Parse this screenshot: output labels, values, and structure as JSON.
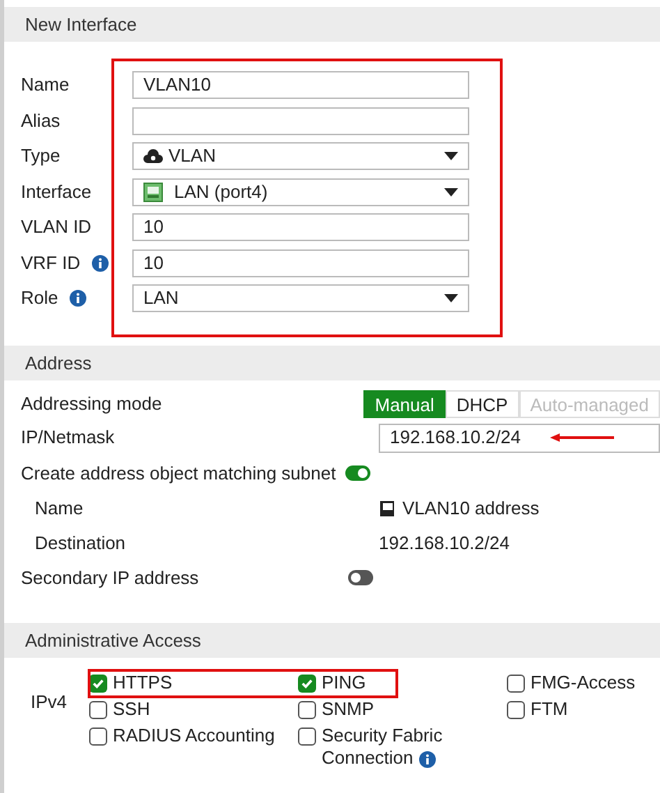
{
  "sections": [
    {
      "title": "New Interface"
    },
    {
      "title": "Address"
    },
    {
      "title": "Administrative Access"
    }
  ],
  "interface_fields": [
    {
      "label": "Name",
      "kind": "text",
      "value": "VLAN10",
      "info": false
    },
    {
      "label": "Alias",
      "kind": "text",
      "info": false
    },
    {
      "label": "Type",
      "kind": "select",
      "value": "VLAN",
      "info": false
    },
    {
      "label": "Interface",
      "kind": "select",
      "value": "LAN (port4)",
      "info": false
    },
    {
      "label": "VLAN ID",
      "kind": "text",
      "value": "10",
      "info": false
    },
    {
      "label": "VRF ID",
      "kind": "text",
      "value": "10",
      "info": true
    },
    {
      "label": "Role",
      "kind": "select",
      "value": "LAN",
      "info": true
    }
  ],
  "address": {
    "mode_label": "Addressing mode",
    "modes": [
      {
        "label": "Manual",
        "selected": true,
        "disabled": false
      },
      {
        "label": "DHCP",
        "selected": false,
        "disabled": false
      },
      {
        "label": "Auto-managed",
        "selected": false,
        "disabled": true
      }
    ],
    "ip_label": "IP/Netmask",
    "ip_value": "192.168.10.2/24",
    "create_label": "Create address object matching subnet",
    "create_on": true,
    "name_label": "Name",
    "name_value": "VLAN10 address",
    "dest_label": "Destination",
    "dest_value": "192.168.10.2/24",
    "secondary_label": "Secondary IP address",
    "secondary_on": false
  },
  "access": {
    "label": "IPv4",
    "options": [
      {
        "label": "HTTPS",
        "checked": true,
        "info": false
      },
      {
        "label": "PING",
        "checked": true,
        "info": false
      },
      {
        "label": "FMG-Access",
        "checked": false,
        "info": false
      },
      {
        "label": "SSH",
        "checked": false,
        "info": false
      },
      {
        "label": "SNMP",
        "checked": false,
        "info": false
      },
      {
        "label": "FTM",
        "checked": false,
        "info": false
      },
      {
        "label": "RADIUS Accounting",
        "checked": false,
        "info": false
      },
      {
        "label": "Security Fabric Connection",
        "checked": false,
        "info": true
      }
    ]
  }
}
